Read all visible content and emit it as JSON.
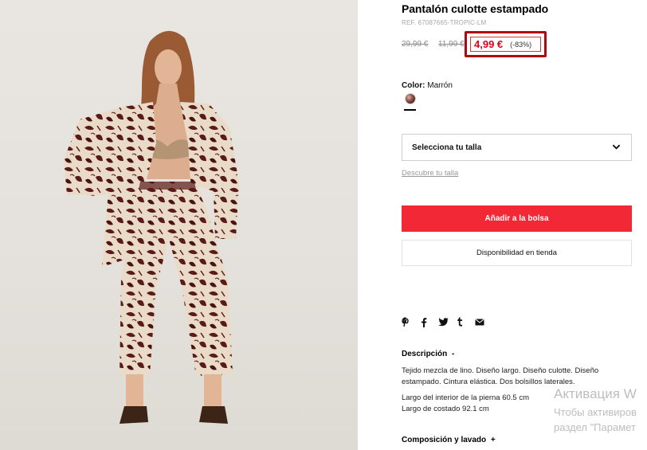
{
  "product": {
    "title": "Pantalón culotte estampado",
    "ref": "REF. 67087665-TROPIC-LM",
    "price_original": "29,99 €",
    "price_previous": "11,99 €",
    "price_current": "4,99 €",
    "discount": "(-83%)",
    "color_label": "Color:",
    "color_value": "Marrón",
    "size_select_placeholder": "Selecciona tu talla",
    "size_guide_link": "Descubre tu talla",
    "add_to_bag": "Añadir a la bolsa",
    "store_availability": "Disponibilidad en tienda"
  },
  "share_icons": [
    "pinterest-icon",
    "facebook-icon",
    "twitter-icon",
    "tumblr-icon",
    "email-icon"
  ],
  "description": {
    "title": "Descripción",
    "toggle": "-",
    "text": "Tejido mezcla de lino. Diseño largo. Diseño culotte. Diseño estampado. Cintura elástica. Dos bolsillos laterales.",
    "inner_leg": "Largo del interior de la pierna 60.5 cm",
    "side_length": "Largo de costado 92.1 cm"
  },
  "composition": {
    "title": "Composición y lavado",
    "toggle": "+"
  },
  "watermark": {
    "line1": "Активация W",
    "line2": "Чтобы активиров",
    "line3": "раздел \"Парамет"
  },
  "colors": {
    "accent_red": "#f32837",
    "price_red": "#e0001a",
    "highlight_border": "#b0070f"
  }
}
